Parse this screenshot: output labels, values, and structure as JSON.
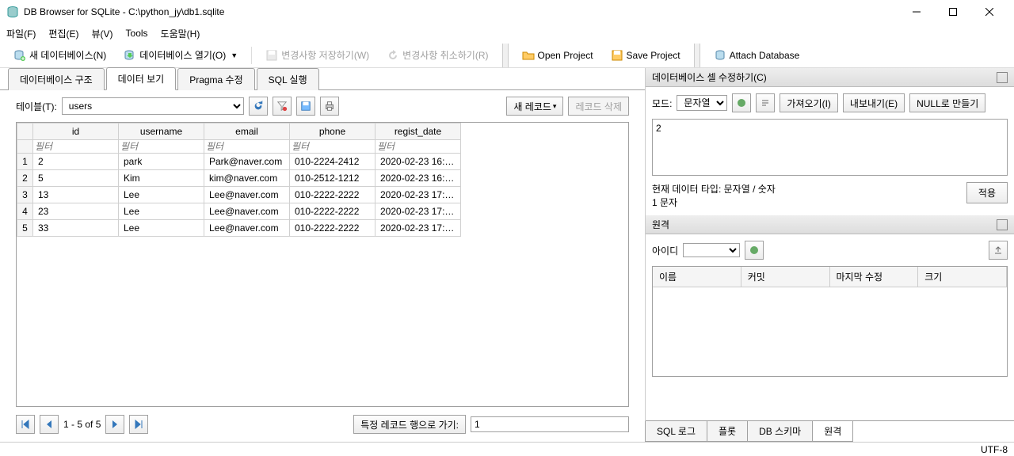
{
  "window": {
    "title": "DB Browser for SQLite - C:\\python_jy\\db1.sqlite"
  },
  "menu": {
    "file": "파일(F)",
    "edit": "편집(E)",
    "view": "뷰(V)",
    "tools": "Tools",
    "help": "도움말(H)"
  },
  "toolbar": {
    "new_db": "새 데이터베이스(N)",
    "open_db": "데이터베이스 열기(O)",
    "save_changes": "변경사항 저장하기(W)",
    "revert_changes": "변경사항 취소하기(R)",
    "open_project": "Open Project",
    "save_project": "Save Project",
    "attach_db": "Attach Database"
  },
  "tabs": {
    "structure": "데이터베이스 구조",
    "browse": "데이터 보기",
    "pragma": "Pragma 수정",
    "sql": "SQL 실행"
  },
  "browse": {
    "table_label": "테이블(T):",
    "table_selected": "users",
    "new_record": "새 레코드",
    "delete_record": "레코드 삭제",
    "columns": [
      "id",
      "username",
      "email",
      "phone",
      "regist_date"
    ],
    "filter_placeholder": "필터",
    "rows": [
      {
        "n": "1",
        "id": "2",
        "username": "park",
        "email": "Park@naver.com",
        "phone": "010-2224-2412",
        "regist_date": "2020-02-23 16:…"
      },
      {
        "n": "2",
        "id": "5",
        "username": "Kim",
        "email": "kim@naver.com",
        "phone": "010-2512-1212",
        "regist_date": "2020-02-23 16:…"
      },
      {
        "n": "3",
        "id": "13",
        "username": "Lee",
        "email": "Lee@naver.com",
        "phone": "010-2222-2222",
        "regist_date": "2020-02-23 17:…"
      },
      {
        "n": "4",
        "id": "23",
        "username": "Lee",
        "email": "Lee@naver.com",
        "phone": "010-2222-2222",
        "regist_date": "2020-02-23 17:…"
      },
      {
        "n": "5",
        "id": "33",
        "username": "Lee",
        "email": "Lee@naver.com",
        "phone": "010-2222-2222",
        "regist_date": "2020-02-23 17:…"
      }
    ],
    "pager_status": "1 - 5 of 5",
    "goto_label": "특정 레코드 행으로 가기:",
    "goto_value": "1"
  },
  "cell_editor": {
    "panel_title": "데이터베이스 셀 수정하기(C)",
    "mode_label": "모드:",
    "mode_value": "문자열",
    "import_btn": "가져오기(I)",
    "export_btn": "내보내기(E)",
    "null_btn": "NULL로 만들기",
    "cell_value": "2",
    "type_info": "현재 데이터 타입: 문자열 / 숫자",
    "char_count": "1 문자",
    "apply_btn": "적용"
  },
  "remote": {
    "panel_title": "원격",
    "id_label": "아이디",
    "cols": {
      "name": "이름",
      "commit": "커밋",
      "last_mod": "마지막 수정",
      "size": "크기"
    }
  },
  "bottom_tabs": {
    "sql_log": "SQL 로그",
    "plot": "플롯",
    "schema": "DB 스키마",
    "remote": "원격"
  },
  "status": {
    "encoding": "UTF-8"
  }
}
